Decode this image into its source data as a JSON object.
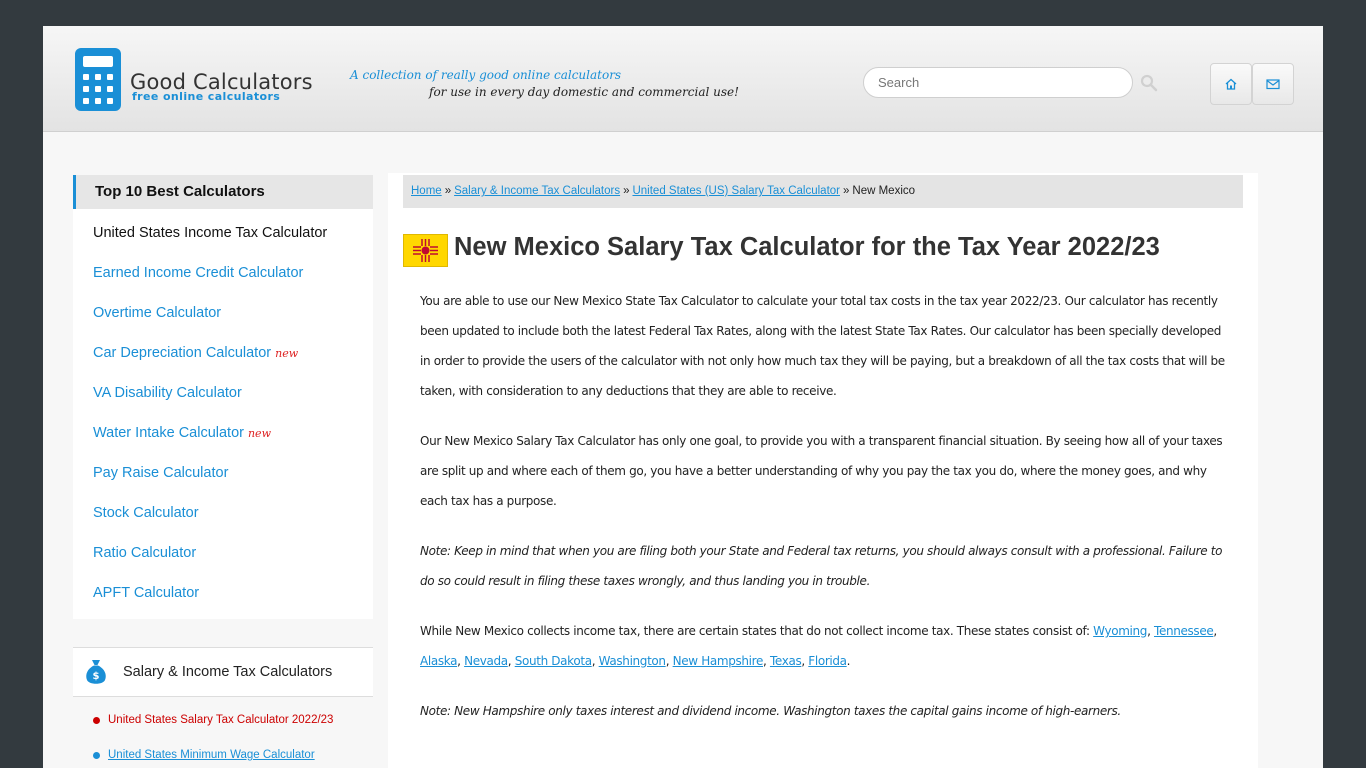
{
  "header": {
    "logo_title": "Good Calculators",
    "logo_subtitle": "free online calculators",
    "tagline_line1": "A collection of really good online calculators",
    "tagline_line2": "for use in every day domestic and commercial use!",
    "search_placeholder": "Search",
    "search_icon": "search-icon",
    "home_icon": "home-icon",
    "mail_icon": "mail-icon",
    "accent_color": "#1a8fd6"
  },
  "sidebar": {
    "top10_title": "Top 10 Best Calculators",
    "top10_items": [
      {
        "label": "United States Income Tax Calculator",
        "new": ""
      },
      {
        "label": "Earned Income Credit Calculator",
        "new": ""
      },
      {
        "label": "Overtime Calculator",
        "new": ""
      },
      {
        "label": "Car Depreciation Calculator",
        "new": "new"
      },
      {
        "label": "VA Disability Calculator",
        "new": ""
      },
      {
        "label": "Water Intake Calculator",
        "new": "new"
      },
      {
        "label": "Pay Raise Calculator",
        "new": ""
      },
      {
        "label": "Stock Calculator",
        "new": ""
      },
      {
        "label": "Ratio Calculator",
        "new": ""
      },
      {
        "label": "APFT Calculator",
        "new": ""
      }
    ],
    "category_title": "Salary & Income Tax Calculators",
    "category_items": [
      "United States Salary Tax Calculator 2022/23",
      "United States Minimum Wage Calculator"
    ]
  },
  "breadcrumb": {
    "home": "Home",
    "sep": "»",
    "crumb1": "Salary & Income Tax Calculators",
    "crumb2": "United States (US) Salary Tax Calculator",
    "current": "New Mexico"
  },
  "main": {
    "title": "New Mexico Salary Tax Calculator for the Tax Year 2022/23",
    "p1": "You are able to use our New Mexico State Tax Calculator to calculate your total tax costs in the tax year 2022/23. Our calculator has recently been updated to include both the latest Federal Tax Rates, along with the latest State Tax Rates. Our calculator has been specially developed in order to provide the users of the calculator with not only how much tax they will be paying, but a breakdown of all the tax costs that will be taken, with consideration to any deductions that they are able to receive.",
    "p2": "Our New Mexico Salary Tax Calculator has only one goal, to provide you with a transparent financial situation. By seeing how all of your taxes are split up and where each of them go, you have a better understanding of why you pay the tax you do, where the money goes, and why each tax has a purpose.",
    "note1": "Note: Keep in mind that when you are filing both your State and Federal tax returns, you should always consult with a professional. Failure to do so could result in filing these taxes wrongly, and thus landing you in trouble.",
    "p3_intro": "While New Mexico collects income tax, there are certain states that do not collect income tax. These states consist of:",
    "states": [
      "Wyoming",
      "Tennessee",
      "Alaska",
      "Nevada",
      "South Dakota",
      "Washington",
      "New Hampshire",
      "Texas",
      "Florida"
    ],
    "comma": ", ",
    "period": ".",
    "note2": "Note: New Hampshire only taxes interest and dividend income. Washington taxes the capital gains income of high-earners."
  }
}
